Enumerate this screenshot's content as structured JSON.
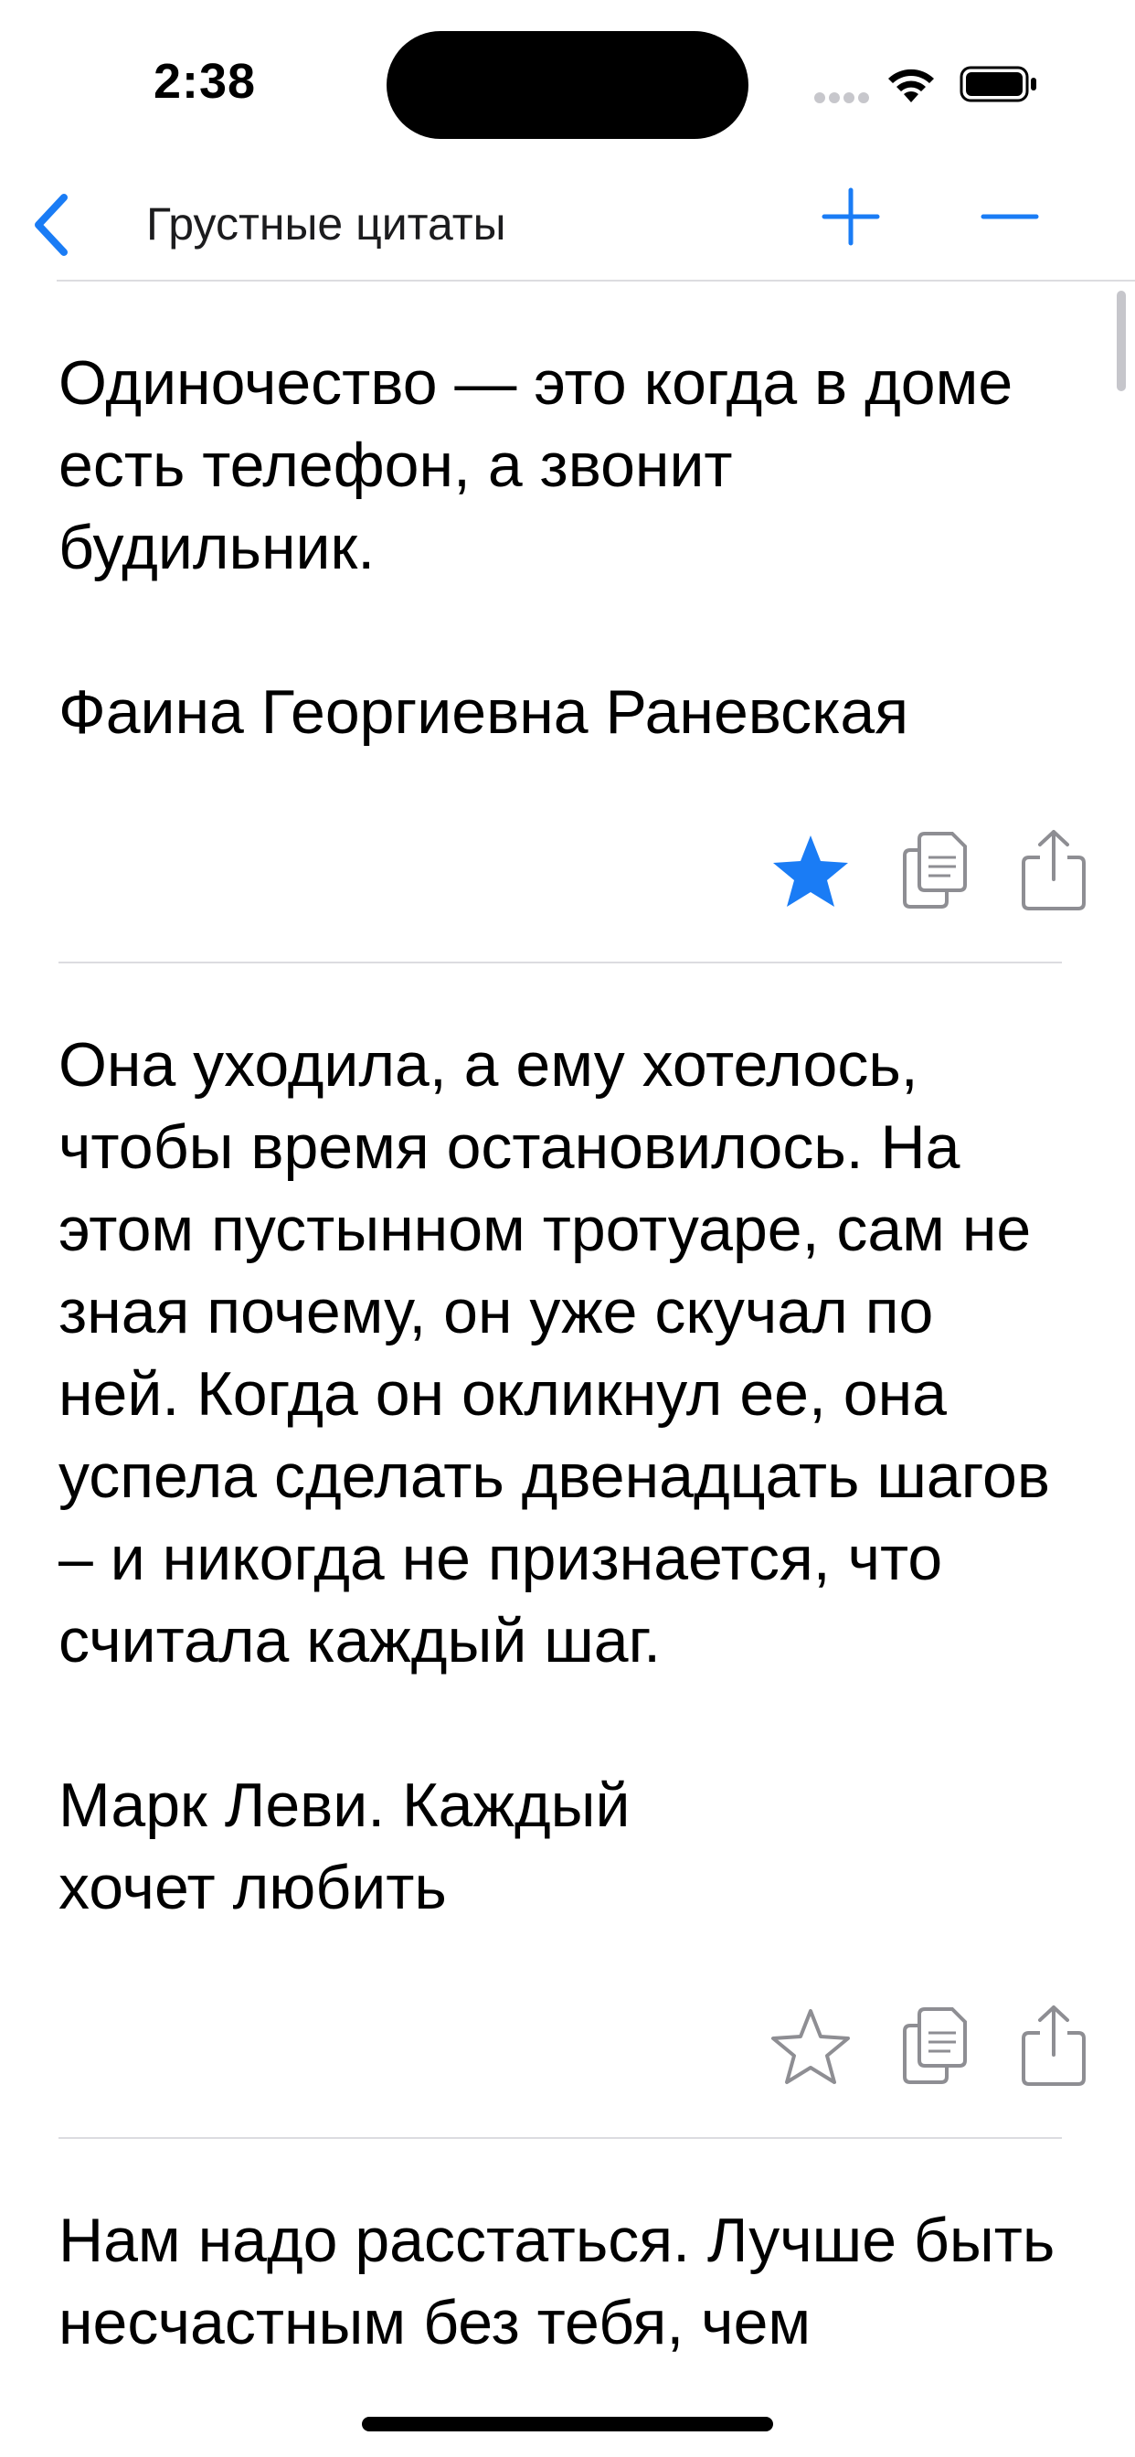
{
  "status_bar": {
    "time": "2:38",
    "icons": [
      "cellular-signal-icon",
      "wifi-icon",
      "battery-icon"
    ]
  },
  "nav": {
    "back_icon": "chevron-left-icon",
    "title": "Грустные цитаты",
    "add_icon": "plus-icon",
    "remove_icon": "minus-icon"
  },
  "colors": {
    "accent": "#1a7cf5",
    "icon_gray": "#8e8e93",
    "divider": "#dcdce0"
  },
  "quotes": [
    {
      "text": "Одиночество — это когда в доме есть телефон, а звонит будильник.",
      "author": "Фаина Георгиевна Раневская",
      "favorite": true
    },
    {
      "text": "Она уходила, а ему хотелось, чтобы время остановилось. На этом пустынном тротуаре, сам не зная почему, он уже скучал по ней. Когда он окликнул ее, она успела сделать двенадцать шагов – и никогда не признается, что считала каждый шаг.",
      "author": "Марк Леви. Каждый хочет любить",
      "favorite": false
    },
    {
      "text": "Нам надо расстаться. Лучше быть несчастным без тебя, чем",
      "author": "",
      "favorite": false
    }
  ]
}
